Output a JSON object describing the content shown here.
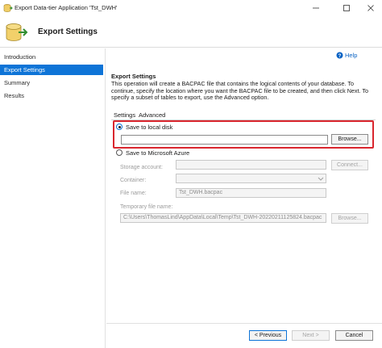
{
  "window": {
    "title": "Export Data-tier Application 'Tst_DWH'",
    "icon": "database-export-icon",
    "controls": [
      "minimize-icon",
      "maximize-icon",
      "close-icon"
    ]
  },
  "header": {
    "title": "Export Settings",
    "icon": "database-export-icon"
  },
  "sidebar": {
    "items": [
      {
        "label": "Introduction",
        "active": false
      },
      {
        "label": "Export Settings",
        "active": true
      },
      {
        "label": "Summary",
        "active": false
      },
      {
        "label": "Results",
        "active": false
      }
    ]
  },
  "main": {
    "help_label": "Help",
    "section_title": "Export Settings",
    "description": "This operation will create a BACPAC file that contains the logical contents of your database. To continue, specify the location where you want the BACPAC file to be created, and then click Next. To specify a subset of tables to export, use the Advanced option.",
    "tabs": [
      {
        "label": "Settings",
        "active": true
      },
      {
        "label": "Advanced",
        "active": false
      }
    ],
    "local": {
      "label": "Save to local disk",
      "selected": true,
      "path_value": "",
      "browse_label": "Browse..."
    },
    "azure": {
      "label": "Save to Microsoft Azure",
      "selected": false,
      "storage_label": "Storage account:",
      "storage_value": "",
      "connect_label": "Connect...",
      "container_label": "Container:",
      "container_value": "",
      "filename_label": "File name:",
      "filename_value": "Tst_DWH.bacpac",
      "temp_label": "Temporary file name:",
      "temp_value": "C:\\Users\\ThomasLind\\AppData\\Local\\Temp\\Tst_DWH-20220211125824.bacpac",
      "temp_browse_label": "Browse..."
    }
  },
  "footer": {
    "previous_label": "< Previous",
    "next_label": "Next >",
    "cancel_label": "Cancel"
  },
  "colors": {
    "accent": "#0e74d7",
    "highlight": "#d9262e"
  }
}
